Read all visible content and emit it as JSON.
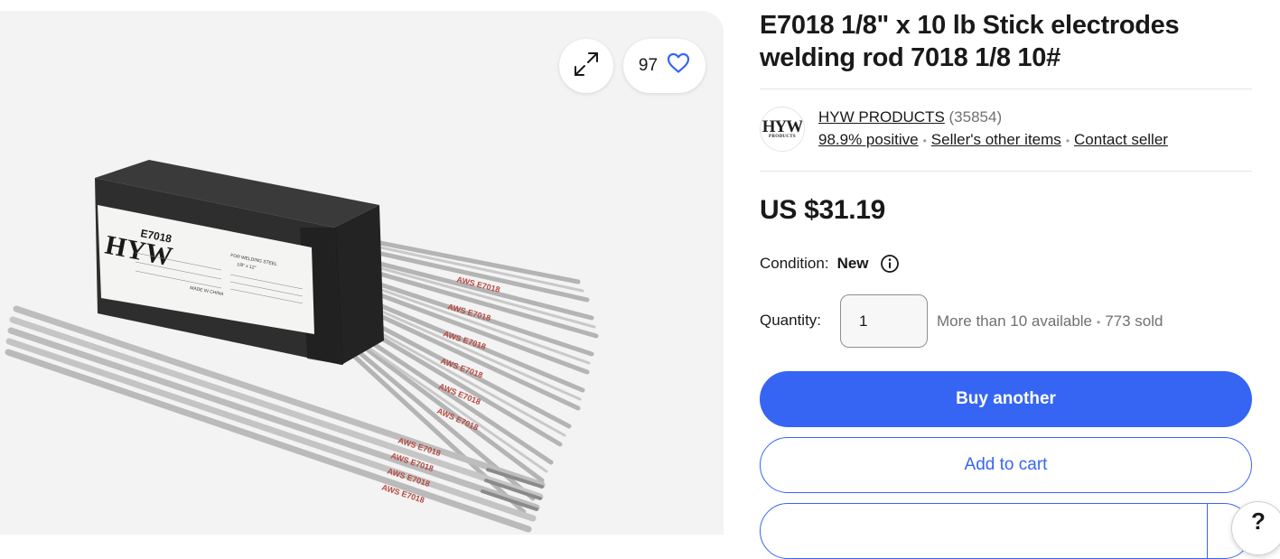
{
  "listing": {
    "title": "E7018 1/8\" x 10 lb Stick electrodes welding rod 7018 1/8 10#",
    "watch_count": "97",
    "image": {
      "box_brand": "HYW",
      "box_model": "E7018",
      "box_heading": "FOR WELDING STEEL",
      "box_size": "1/8\" x 12\"",
      "box_origin": "MADE IN CHINA",
      "rod_print": "AWS E7018"
    }
  },
  "seller": {
    "logo_text": "HYW",
    "logo_subtext": "PRODUCTS",
    "name": "HYW PRODUCTS",
    "feedback_count": "(35854)",
    "positive": "98.9% positive",
    "other_items": "Seller's other items",
    "contact": "Contact seller"
  },
  "pricing": {
    "price": "US $31.19"
  },
  "condition": {
    "label": "Condition:",
    "value": "New"
  },
  "quantity": {
    "label": "Quantity:",
    "value": "1",
    "available": "More than 10 available",
    "sold": "773 sold"
  },
  "actions": {
    "buy": "Buy another",
    "cart": "Add to cart"
  },
  "help": {
    "label": "?"
  },
  "colors": {
    "accent": "#3665f3",
    "image_bg": "#f3f3f3",
    "muted_text": "#707070"
  },
  "icons": [
    "expand-icon",
    "heart-icon",
    "info-icon",
    "help-icon"
  ]
}
